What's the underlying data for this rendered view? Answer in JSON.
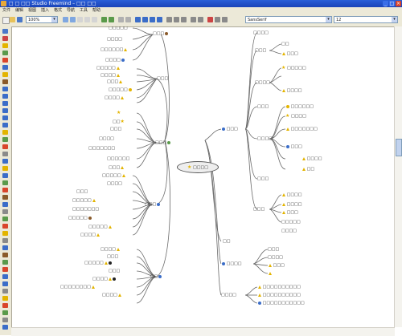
{
  "window": {
    "title": "□ □ □□ Studio Freemind – □□ □□",
    "minimize": "_",
    "maximize": "□",
    "close": "×"
  },
  "menu": [
    "文件",
    "编辑",
    "视图",
    "插入",
    "格式",
    "导航",
    "工具",
    "帮助"
  ],
  "toolbar": {
    "zoom_value": "100%",
    "font_value": "SansSerif",
    "size_value": "12"
  },
  "colors": {
    "accent": "#2a5fd8",
    "edge": "#6a6a6a",
    "warn": "#e3b400",
    "chrome": "#ece9d8"
  },
  "mindmap": {
    "center": "□□□□",
    "left_branches": [
      {
        "label": "□□□",
        "children": [
          "□□□□□",
          "□□□□",
          "□□□□□□",
          "□□□□",
          "□□□□□",
          "□□□□",
          "□□□",
          "□□□□□",
          "□□□□"
        ]
      },
      {
        "label": "□□□",
        "children": [
          "□□",
          "□□□",
          "□□□□",
          "□□□□□□□",
          "□□□□□□",
          "□□□"
        ]
      },
      {
        "label": "□□□",
        "children": [
          "□□□□□",
          "□□□□",
          "□□□",
          "□□□□□",
          "□□□□□□□",
          "□□□□□",
          "□□□□□",
          "□□□□"
        ]
      },
      {
        "label": "□□",
        "children": [
          "□□□□",
          "□□□",
          "□□□□□",
          "□□□",
          "□□□□",
          "□□□□□□□□",
          "□□□□"
        ]
      }
    ],
    "right_branches": [
      {
        "label": "□□□",
        "children": [
          "□□□□",
          "□□□",
          "□□",
          "□□□",
          "□□□□",
          "□□□□□",
          "□□□□",
          "□□□",
          "□□□□□□",
          "□□□□",
          "□□□□□□□",
          "□□□□",
          "□□□"
        ]
      },
      {
        "label": "□□□",
        "children": [
          "□□□□",
          "□□□□",
          "□□□",
          "□□□□□",
          "□□□□"
        ]
      },
      {
        "label": "□□",
        "children": []
      },
      {
        "label": "□□□□",
        "children": [
          "□□□",
          "□□□□",
          "□□□"
        ]
      },
      {
        "label": "□□□□",
        "children": [
          "□□□□□□□□□□",
          "□□□□□□□□□□",
          "□□□□□□□□□□□"
        ]
      }
    ]
  }
}
